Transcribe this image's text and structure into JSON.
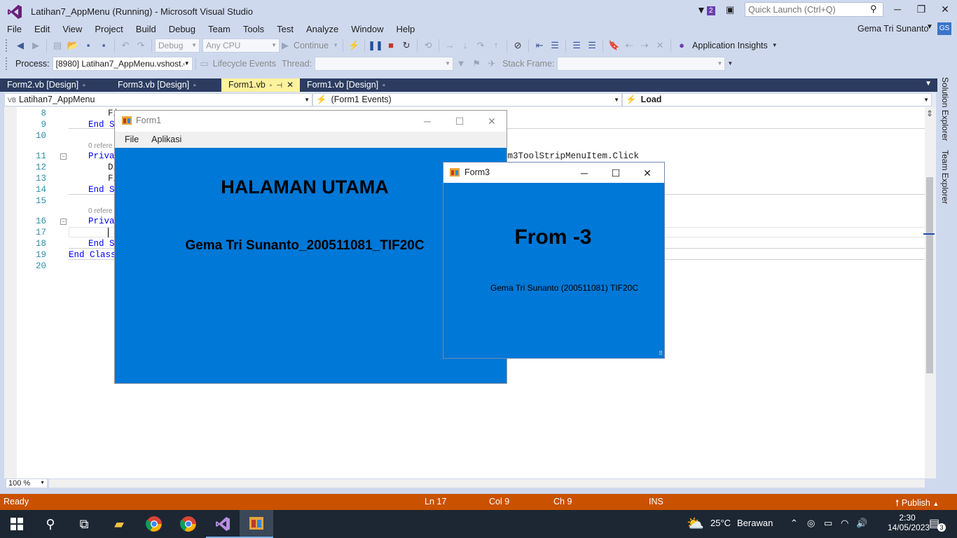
{
  "window": {
    "title": "Latihan7_AppMenu (Running) - Microsoft Visual Studio",
    "notification_count": "2",
    "quick_launch_placeholder": "Quick Launch (Ctrl+Q)",
    "icons": [
      "vs-logo-icon",
      "filter-icon",
      "feedback-icon",
      "search-icon",
      "minimize-icon",
      "restore-icon",
      "close-icon"
    ]
  },
  "menu": {
    "items": [
      "File",
      "Edit",
      "View",
      "Project",
      "Build",
      "Debug",
      "Team",
      "Tools",
      "Test",
      "Analyze",
      "Window",
      "Help"
    ],
    "user_name": "Gema Tri Sunanto",
    "user_initials": "GS"
  },
  "toolbar1": {
    "config": "Debug",
    "platform": "Any CPU",
    "continue_label": "Continue",
    "insights_label": "Application Insights"
  },
  "toolbar2": {
    "process_label": "Process:",
    "process_value": "[8980] Latihan7_AppMenu.vshost.e",
    "lifecycle_label": "Lifecycle Events",
    "thread_label": "Thread:",
    "stackframe_label": "Stack Frame:"
  },
  "doc_tabs": [
    {
      "label": "Form2.vb [Design]",
      "active": false
    },
    {
      "label": "Form3.vb [Design]",
      "active": false
    },
    {
      "label": "Form1.vb",
      "active": true
    },
    {
      "label": "Form1.vb [Design]",
      "active": false
    }
  ],
  "navbar": {
    "project": "Latihan7_AppMenu",
    "object": "(Form1 Events)",
    "member": "Load"
  },
  "editor": {
    "lines": [
      {
        "n": "8",
        "text": "Fi"
      },
      {
        "n": "9",
        "text": "End Su"
      },
      {
        "n": "10",
        "text": ""
      },
      {
        "n": "11",
        "text": "Privat",
        "ref": "0 refere",
        "tail": "om3ToolStripMenuItem.Click"
      },
      {
        "n": "12",
        "text": "Di"
      },
      {
        "n": "13",
        "text": "Fi"
      },
      {
        "n": "14",
        "text": "End Su"
      },
      {
        "n": "15",
        "text": ""
      },
      {
        "n": "16",
        "text": "Privat",
        "ref": "0 refere"
      },
      {
        "n": "17",
        "text": ""
      },
      {
        "n": "18",
        "text": "End Su"
      },
      {
        "n": "19",
        "text": "End Class"
      },
      {
        "n": "20",
        "text": ""
      }
    ],
    "zoom": "100 %"
  },
  "side_tabs": [
    "Solution Explorer",
    "Team Explorer"
  ],
  "form1": {
    "caption": "Form1",
    "menu": [
      "File",
      "Aplikasi"
    ],
    "heading": "HALAMAN UTAMA",
    "subtitle": "Gema Tri Sunanto_200511081_TIF20C",
    "background": "#0078d7"
  },
  "form3": {
    "caption": "Form3",
    "heading": "From -3",
    "subtitle": "Gema Tri Sunanto (200511081) TIF20C",
    "background": "#0078d7"
  },
  "statusbar": {
    "status": "Ready",
    "line": "Ln 17",
    "col": "Col 9",
    "ch": "Ch 9",
    "mode": "INS",
    "publish": "Publish",
    "color": "#ca5100"
  },
  "taskbar": {
    "weather_temp": "25°C",
    "weather_desc": "Berawan",
    "time": "2:30",
    "date": "14/05/2023",
    "notification_count": "3"
  }
}
